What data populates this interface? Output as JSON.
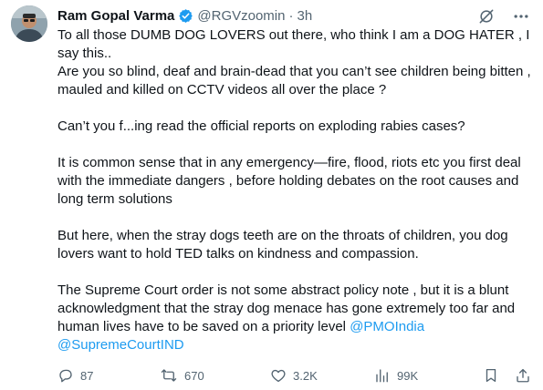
{
  "author": {
    "display_name": "Ram Gopal Varma",
    "handle": "@RGVzoomin",
    "separator": "·",
    "time": "3h"
  },
  "tweet": {
    "lines": [
      "To all those DUMB DOG LOVERS out there,  who think I am a DOG HATER , I say this..",
      "Are you so blind, deaf and brain-dead that you can’t see children being bitten , mauled and killed on CCTV videos all over the place ?",
      "Can’t you f...ing read the official reports on exploding rabies cases?",
      "It is common sense that in any emergency—fire, flood, riots etc you first deal with the immediate dangers , before holding debates on the root causes and long term solutions",
      "But here, when the stray dogs teeth are on the throats of children, you dog lovers want to hold TED talks on kindness and compassion.",
      "The Supreme Court order is not some abstract policy note , but it is a blunt acknowledgment that the stray dog menace has gone extremely too far and human lives have to be saved on a priority level "
    ],
    "mentions": [
      "@PMOIndia",
      "@SupremeCourtIND"
    ]
  },
  "actions": {
    "replies": "87",
    "reposts": "670",
    "likes": "3.2K",
    "views": "99K"
  },
  "icons": {
    "verified": "verified-badge-icon",
    "grok": "grok-icon",
    "more": "more-icon",
    "reply": "reply-icon",
    "repost": "repost-icon",
    "like": "heart-icon",
    "views": "views-icon",
    "bookmark": "bookmark-icon",
    "share": "share-icon"
  },
  "colors": {
    "accent": "#1d9bf0",
    "text": "#0f1419",
    "secondary": "#536471"
  }
}
